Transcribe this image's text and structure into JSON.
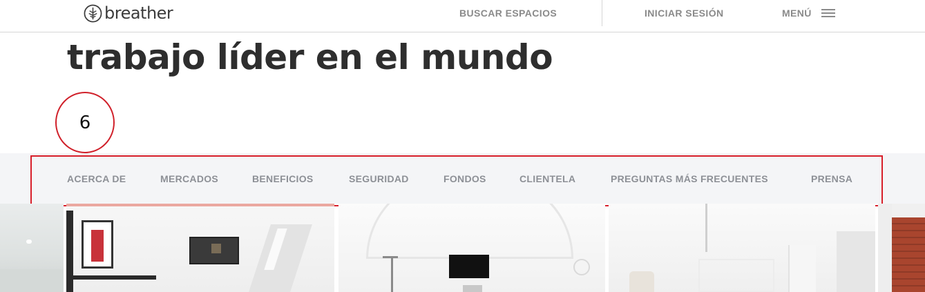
{
  "header": {
    "logo_text": "breather",
    "nav": {
      "search_spaces": "BUSCAR ESPACIOS",
      "sign_in": "INICIAR SESIÓN",
      "menu": "MENÚ"
    }
  },
  "hero": {
    "headline": "trabajo líder en el mundo"
  },
  "annotation": {
    "step_number": "6"
  },
  "subnav": {
    "items": [
      "ACERCA DE",
      "MERCADOS",
      "BENEFICIOS",
      "SEGURIDAD",
      "FONDOS",
      "CLIENTELA",
      "PREGUNTAS MÁS FRECUENTES",
      "PRENSA"
    ]
  },
  "colors": {
    "highlight": "#d81f2a",
    "subnav_text": "#8d9096",
    "subnav_bg": "#f4f5f7"
  }
}
